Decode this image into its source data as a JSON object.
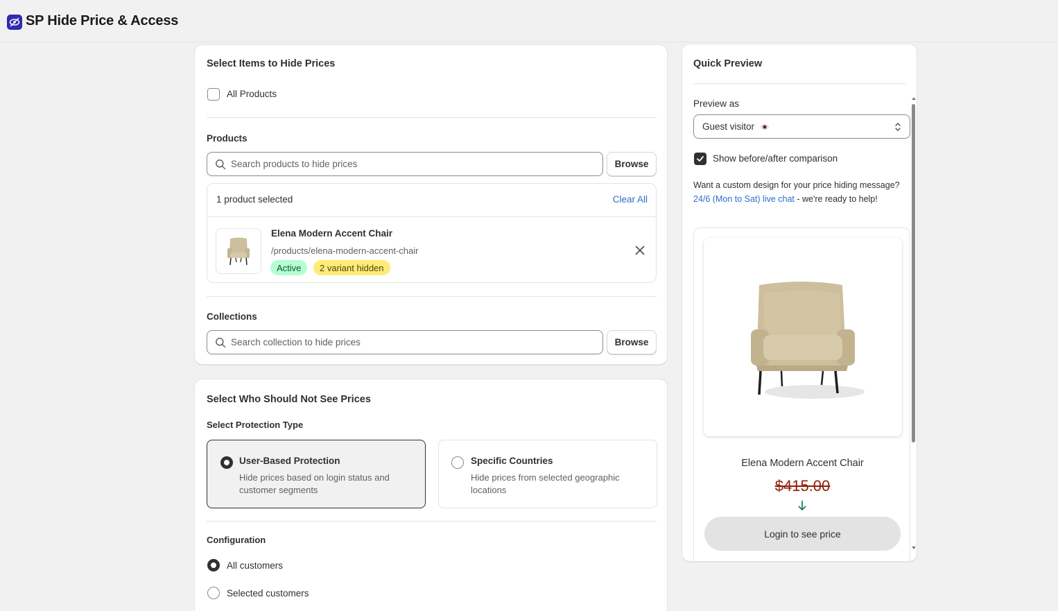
{
  "app": {
    "title": "SP Hide Price & Access"
  },
  "items_card": {
    "title": "Select Items to Hide Prices",
    "all_products_label": "All Products",
    "products_label": "Products",
    "products_search_placeholder": "Search products to hide prices",
    "browse_label": "Browse",
    "selected_count": "1 product selected",
    "clear_all": "Clear All",
    "product": {
      "name": "Elena Modern Accent Chair",
      "handle": "/products/elena-modern-accent-chair",
      "status": "Active",
      "variants": "2 variant hidden"
    },
    "collections_label": "Collections",
    "collections_search_placeholder": "Search collection to hide prices"
  },
  "who_card": {
    "title": "Select Who Should Not See Prices",
    "protection_label": "Select Protection Type",
    "options": [
      {
        "title": "User-Based Protection",
        "desc": "Hide prices based on login status and customer segments",
        "selected": true
      },
      {
        "title": "Specific Countries",
        "desc": "Hide prices from selected geographic locations",
        "selected": false
      }
    ],
    "configuration_label": "Configuration",
    "config_options": [
      {
        "label": "All customers",
        "selected": true
      },
      {
        "label": "Selected customers",
        "selected": false
      }
    ]
  },
  "preview_card": {
    "title": "Quick Preview",
    "preview_as_label": "Preview as",
    "preview_as_value": "Guest visitor",
    "comparison_label": "Show before/after comparison",
    "comparison_checked": true,
    "help_text_before": "Want a custom design for your price hiding message?",
    "help_link": "24/6 (Mon to Sat) live chat",
    "help_text_after": "- we're ready to help!",
    "product_name": "Elena Modern Accent Chair",
    "old_price": "$415.00",
    "cta": "Login to see price"
  },
  "colors": {
    "accent": "#2f2ab0",
    "link": "#2c6ecb",
    "strike_price": "#8e1f0b",
    "arrow": "#0c7a43"
  },
  "icons": [
    "eye-off-icon",
    "search-icon",
    "close-icon",
    "select-chevron-icon",
    "eye-icon",
    "checkmark-icon",
    "arrow-down-icon",
    "chair-image"
  ]
}
